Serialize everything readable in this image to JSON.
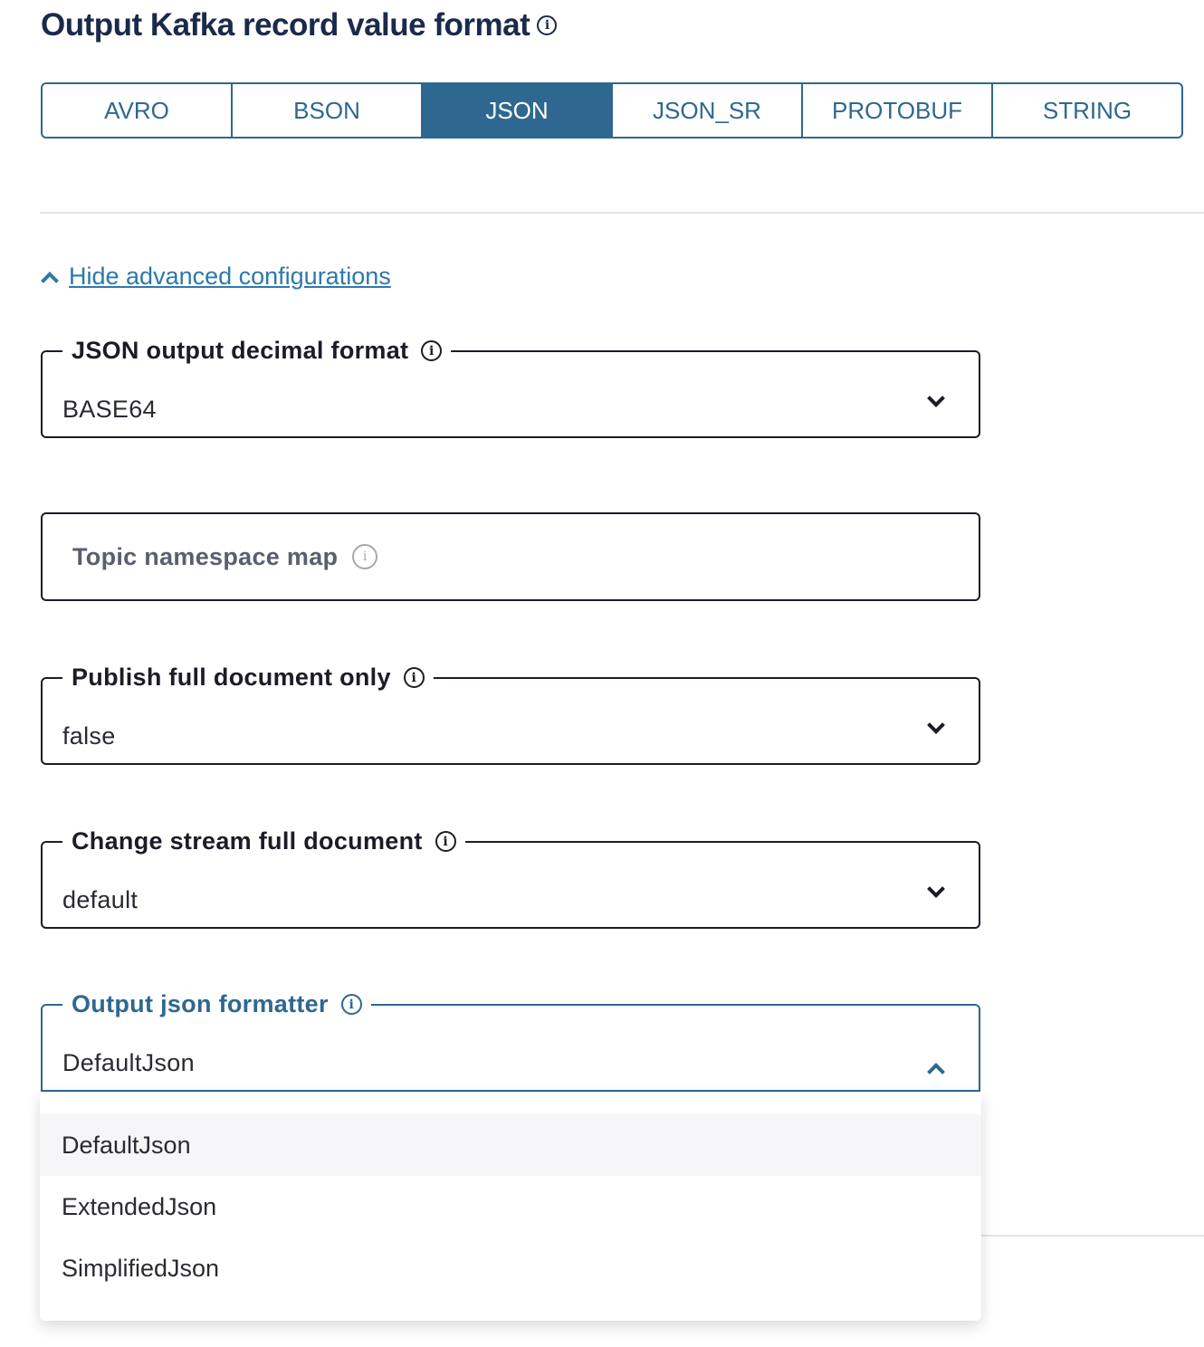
{
  "title": "Output Kafka record value format",
  "tabs": [
    "AVRO",
    "BSON",
    "JSON",
    "JSON_SR",
    "PROTOBUF",
    "STRING"
  ],
  "active_tab": "JSON",
  "advanced_link": "Hide advanced configurations",
  "fields": {
    "decimal": {
      "label": "JSON output decimal format",
      "value": "BASE64"
    },
    "topic": {
      "placeholder": "Topic namespace map"
    },
    "publish": {
      "label": "Publish full document only",
      "value": "false"
    },
    "change": {
      "label": "Change stream full document",
      "value": "default"
    },
    "formatter": {
      "label": "Output json formatter",
      "value": "DefaultJson",
      "options": [
        "DefaultJson",
        "ExtendedJson",
        "SimplifiedJson"
      ]
    }
  },
  "colors": {
    "accent": "#2e6890",
    "link": "#2e79aa",
    "title": "#1b2a4a"
  }
}
